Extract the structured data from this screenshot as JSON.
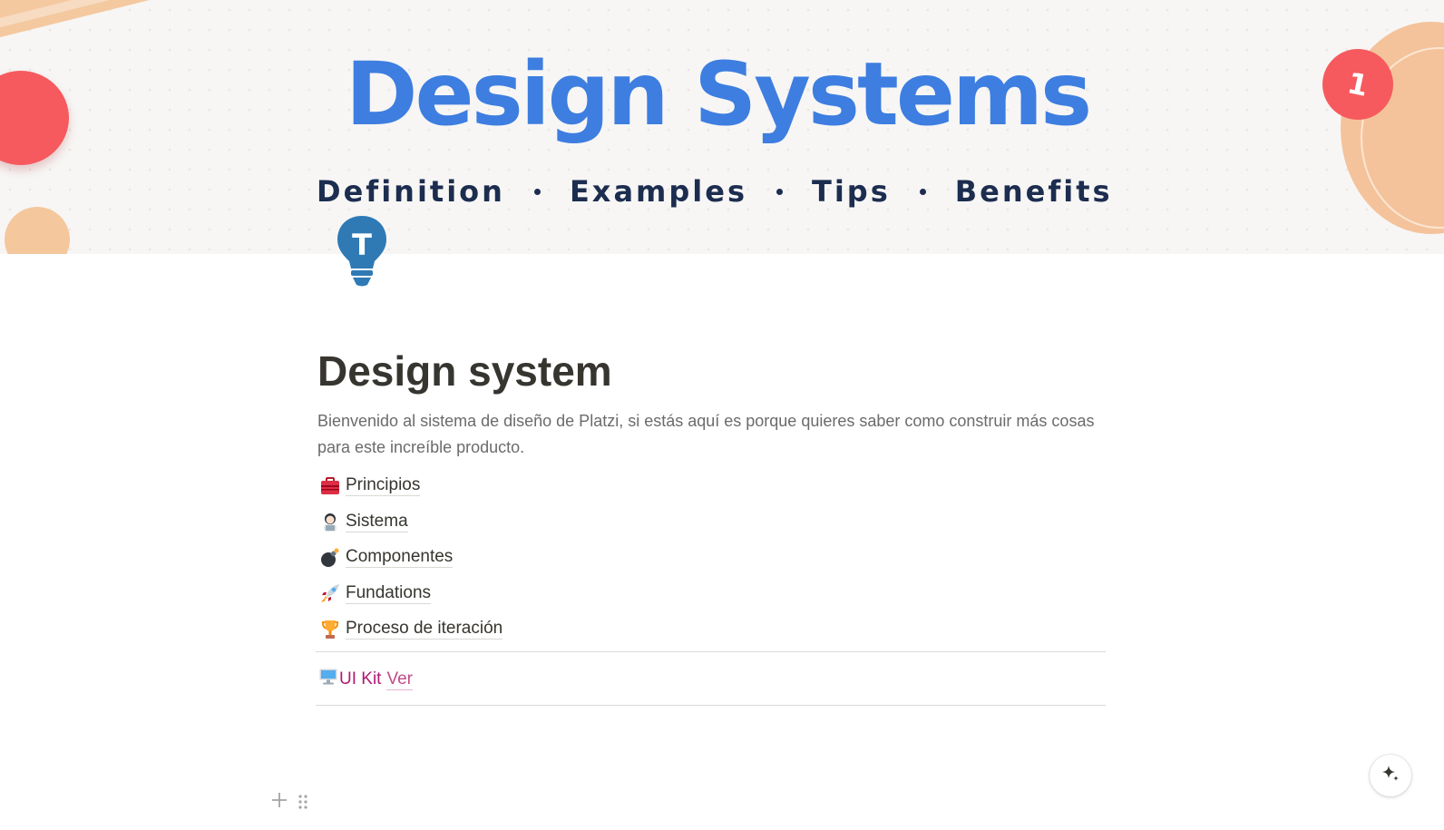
{
  "cover": {
    "title": "Design Systems",
    "subtitle_items": [
      "Definition",
      "Examples",
      "Tips",
      "Benefits"
    ],
    "badge": "1",
    "title_color": "#3d7ee0",
    "accent_red": "#f65a5e",
    "accent_peach": "#f4c39b"
  },
  "page_icon": {
    "name": "lightbulb-t-icon",
    "letter": "T",
    "color": "#2f7ab5"
  },
  "page": {
    "title": "Design system",
    "description": "Bienvenido al sistema de diseño de Platzi, si estás aquí es porque quieres saber como construir más cosas para este increíble producto."
  },
  "links": [
    {
      "label": "Principios",
      "icon": "toolbox-icon"
    },
    {
      "label": "Sistema",
      "icon": "technologist-icon"
    },
    {
      "label": "Componentes",
      "icon": "bomb-icon"
    },
    {
      "label": "Fundations",
      "icon": "rocket-icon"
    },
    {
      "label": "Proceso de iteración",
      "icon": "trophy-icon"
    }
  ],
  "uikit": {
    "label": "UI Kit",
    "link_label": "Ver",
    "icon": "computer-icon",
    "color": "#ad1a72"
  },
  "controls": {
    "add_block": "+",
    "ai_button_icon": "sparkle-icon"
  }
}
